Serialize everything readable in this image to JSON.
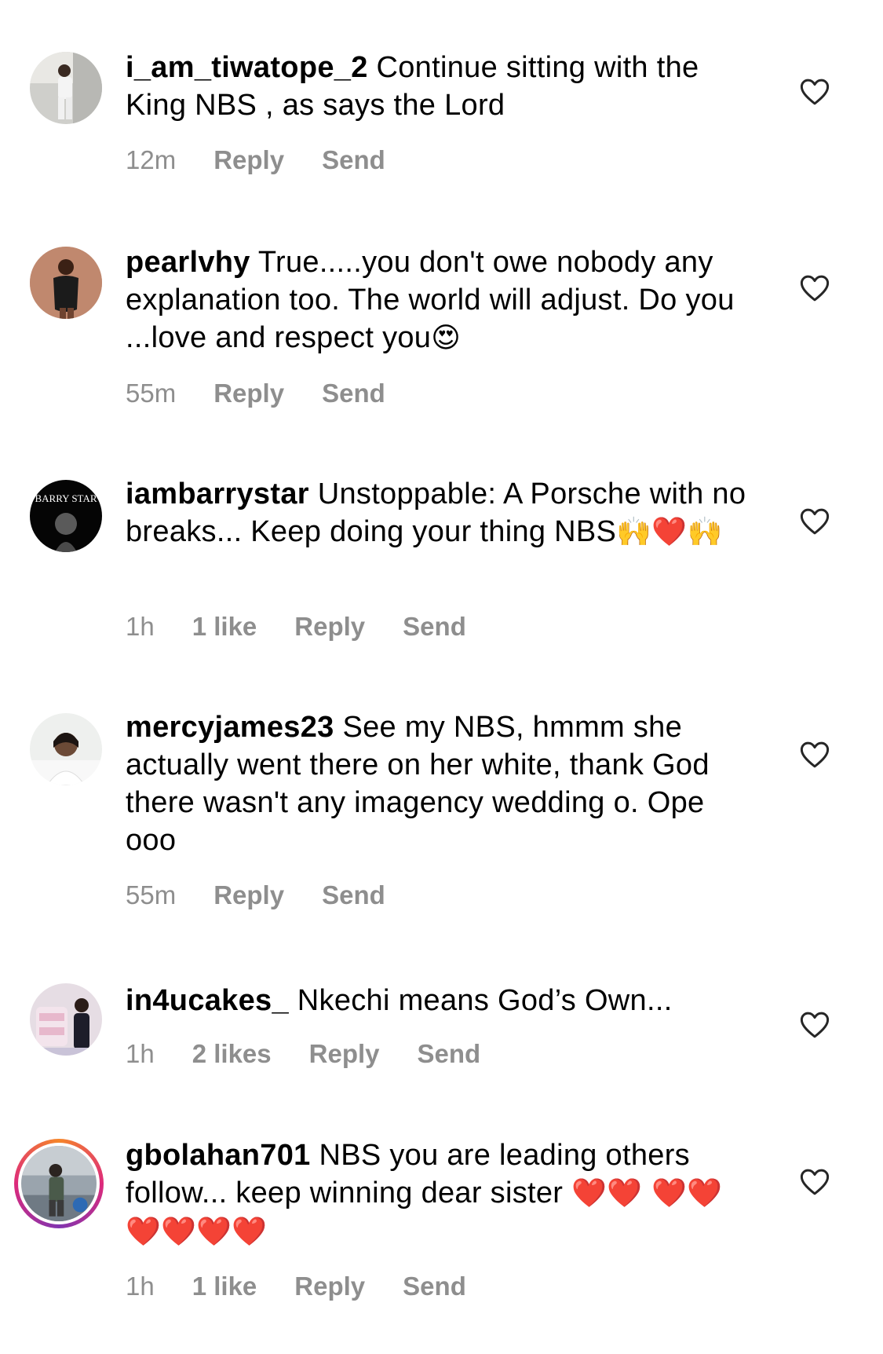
{
  "comments": [
    {
      "username": "i_am_tiwatope_2",
      "text": "Continue sitting with the King NBS , as says the Lord",
      "time": "12m",
      "likes": "",
      "reply": "Reply",
      "send": "Send",
      "avatar_icon": "profile-photo"
    },
    {
      "username": "pearlvhy",
      "text": "True.....you don't owe nobody any explanation too. The world will adjust. Do you ...love and respect you",
      "emoji": "😍",
      "time": "55m",
      "likes": "",
      "reply": "Reply",
      "send": "Send",
      "avatar_icon": "profile-photo"
    },
    {
      "username": "iambarrystar",
      "text": "Unstoppable: A Porsche with no breaks... Keep doing your thing NBS",
      "emoji": "🙌❤️🙌",
      "time": "1h",
      "likes": "1 like",
      "reply": "Reply",
      "send": "Send",
      "avatar_text": "BARRY STAR"
    },
    {
      "username": "mercyjames23",
      "text": "See my NBS, hmmm she actually went there on her white, thank God there wasn't any imagency wedding o. Ope ooo",
      "time": "55m",
      "likes": "",
      "reply": "Reply",
      "send": "Send",
      "avatar_icon": "profile-photo"
    },
    {
      "username": "in4ucakes_",
      "text": "Nkechi means God’s Own...",
      "time": "1h",
      "likes": "2 likes",
      "reply": "Reply",
      "send": "Send",
      "avatar_icon": "profile-photo"
    },
    {
      "username": "gbolahan701",
      "text": "NBS you are leading others follow... keep winning dear sister",
      "emoji": "❤️❤️ ❤️❤️❤️❤️❤️❤️",
      "time": "1h",
      "likes": "1 like",
      "reply": "Reply",
      "send": "Send",
      "avatar_icon": "profile-photo-with-story-ring"
    }
  ],
  "icons": {
    "like": "heart-outline-icon"
  },
  "colors": {
    "text": "#000000",
    "meta": "#8e8e8e",
    "heart_emoji": "#e0242b",
    "story_ring": "#dd2a7b"
  }
}
